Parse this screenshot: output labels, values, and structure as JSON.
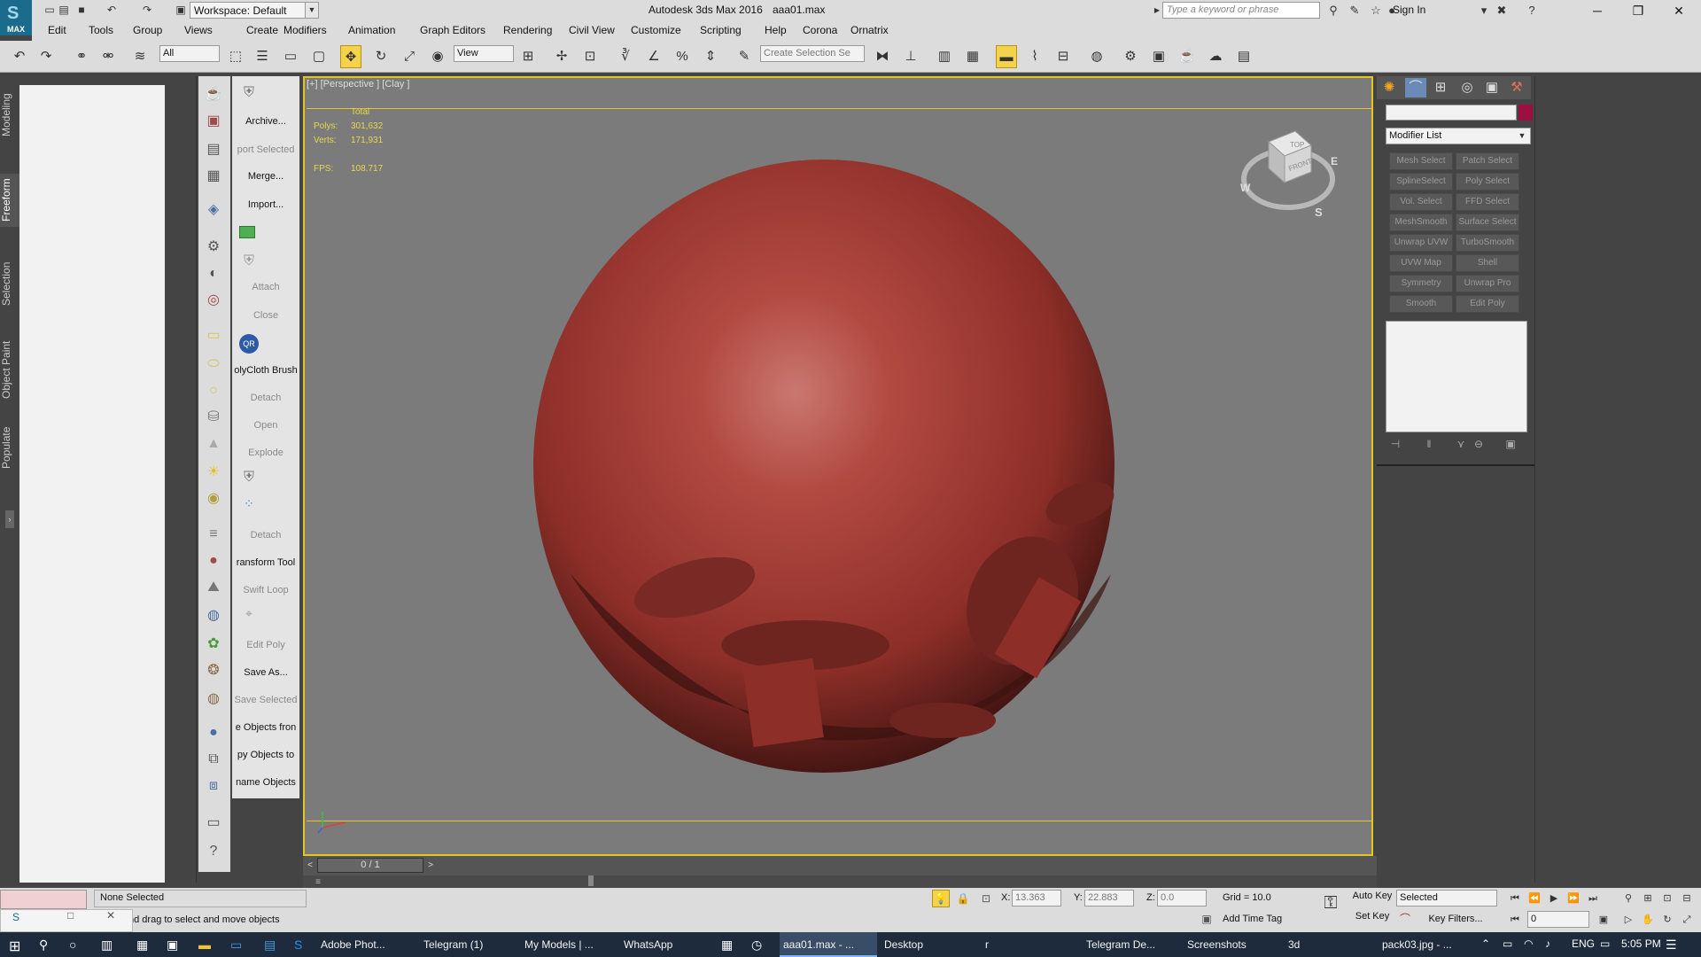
{
  "title_bar": {
    "app_logo_text": "MAX",
    "workspace": "Workspace: Default",
    "app_title": "Autodesk 3ds Max 2016",
    "file_name": "aaa01.max",
    "search_placeholder": "Type a keyword or phrase",
    "sign_in": "Sign In"
  },
  "menu": {
    "items": [
      "Edit",
      "Tools",
      "Group",
      "Views",
      "Create",
      "Modifiers",
      "Animation",
      "Graph Editors",
      "Rendering",
      "Civil View",
      "Customize",
      "Scripting",
      "Help",
      "Corona",
      "Ornatrix"
    ]
  },
  "toolbar": {
    "selection_filter": "All",
    "ref_coord": "View",
    "named_selection_placeholder": "Create Selection Se"
  },
  "ribbon_tabs": [
    "Modeling",
    "Freeform",
    "Selection",
    "Object Paint",
    "Populate"
  ],
  "command_panel": {
    "items": [
      {
        "label": "Archive...",
        "disabled": false
      },
      {
        "label": "port Selected",
        "disabled": true
      },
      {
        "label": "Merge...",
        "disabled": false
      },
      {
        "label": "Import...",
        "disabled": false
      },
      {
        "label": "Attach",
        "disabled": true
      },
      {
        "label": "Close",
        "disabled": true
      },
      {
        "label": "olyCloth Brush",
        "disabled": false
      },
      {
        "label": "Detach",
        "disabled": true
      },
      {
        "label": "Open",
        "disabled": true
      },
      {
        "label": "Explode",
        "disabled": true
      },
      {
        "label": "Detach",
        "disabled": true
      },
      {
        "label": "ransform Tool",
        "disabled": false
      },
      {
        "label": "Swift Loop",
        "disabled": true
      },
      {
        "label": "Edit Poly",
        "disabled": true
      },
      {
        "label": "Save As...",
        "disabled": false
      },
      {
        "label": "Save Selected",
        "disabled": true
      },
      {
        "label": "e Objects fron",
        "disabled": false
      },
      {
        "label": "py Objects to",
        "disabled": false
      },
      {
        "label": "name Objects",
        "disabled": false
      }
    ]
  },
  "viewport": {
    "label": "[+] [Perspective ] [Clay ]",
    "stats": {
      "total_label": "Total",
      "polys_label": "Polys:",
      "polys_value": "301,632",
      "verts_label": "Verts:",
      "verts_value": "171,931",
      "fps_label": "FPS:",
      "fps_value": "108.717"
    },
    "viewcube": {
      "top": "TOP",
      "front": "FRONT",
      "compass": [
        "W",
        "E",
        "S"
      ]
    },
    "object_color": "#b24a42"
  },
  "modify_panel": {
    "modifier_list": "Modifier List",
    "object_color": "#9a1040",
    "modifier_buttons": [
      "Mesh Select",
      "Patch Select",
      "SplineSelect",
      "Poly Select",
      "Vol. Select",
      "FFD Select",
      "MeshSmooth",
      "Surface Select",
      "Unwrap UVW",
      "TurboSmooth",
      "UVW Map",
      "Shell",
      "Symmetry",
      "Unwrap Pro",
      "Smooth",
      "Edit Poly"
    ]
  },
  "time_slider": {
    "frame": "0 / 1"
  },
  "status": {
    "selection": "None Selected",
    "prompt": "Click and drag to select and move objects",
    "x_label": "X:",
    "x_value": "13.363",
    "y_label": "Y:",
    "y_value": "22.883",
    "z_label": "Z:",
    "z_value": "0.0",
    "grid": "Grid = 10.0",
    "add_time_tag": "Add Time Tag",
    "auto_key": "Auto Key",
    "set_key": "Set Key",
    "key_mode": "Selected",
    "key_filters": "Key Filters...",
    "current_frame": "0"
  },
  "taskbar": {
    "items": [
      {
        "label": "Adobe Phot...",
        "active": false
      },
      {
        "label": "Telegram (1)",
        "active": false
      },
      {
        "label": "My Models | ...",
        "active": false
      },
      {
        "label": "WhatsApp",
        "active": false
      },
      {
        "label": "aaa01.max - ...",
        "active": true
      },
      {
        "label": "Desktop",
        "active": false
      },
      {
        "label": "r",
        "active": false
      },
      {
        "label": "Telegram De...",
        "active": false
      },
      {
        "label": "Screenshots",
        "active": false
      },
      {
        "label": "3d",
        "active": false
      },
      {
        "label": "pack03.jpg - ...",
        "active": false
      }
    ],
    "language": "ENG",
    "time": "5:05 PM"
  }
}
